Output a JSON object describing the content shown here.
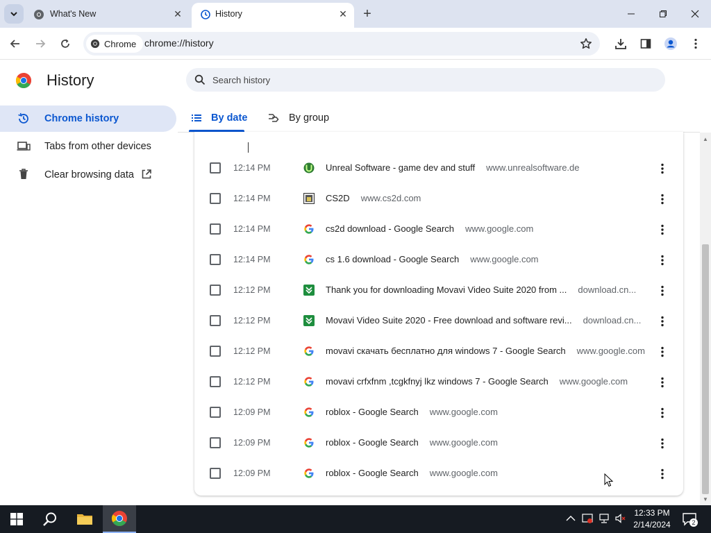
{
  "browser": {
    "tabs": [
      {
        "title": "What's New",
        "active": false
      },
      {
        "title": "History",
        "active": true
      }
    ],
    "address": {
      "chip_label": "Chrome",
      "url": "chrome://history"
    }
  },
  "page": {
    "title": "History",
    "search_placeholder": "Search history"
  },
  "sidebar": {
    "items": [
      {
        "label": "Chrome history",
        "icon": "history-icon",
        "active": true
      },
      {
        "label": "Tabs from other devices",
        "icon": "devices-icon",
        "active": false
      },
      {
        "label": "Clear browsing data",
        "icon": "trash-icon",
        "active": false
      }
    ]
  },
  "view_tabs": [
    {
      "label": "By date",
      "active": true
    },
    {
      "label": "By group",
      "active": false
    }
  ],
  "history": {
    "rows": [
      {
        "time": "12:14 PM",
        "title": "Unreal Software - game dev and stuff",
        "domain": "www.unrealsoftware.de",
        "favicon": "unreal-favicon"
      },
      {
        "time": "12:14 PM",
        "title": "CS2D",
        "domain": "www.cs2d.com",
        "favicon": "cs2d-favicon"
      },
      {
        "time": "12:14 PM",
        "title": "cs2d download - Google Search",
        "domain": "www.google.com",
        "favicon": "google-favicon"
      },
      {
        "time": "12:14 PM",
        "title": "cs 1.6 download - Google Search",
        "domain": "www.google.com",
        "favicon": "google-favicon"
      },
      {
        "time": "12:12 PM",
        "title": "Thank you for downloading Movavi Video Suite 2020 from ...",
        "domain": "download.cn...",
        "favicon": "cnet-favicon"
      },
      {
        "time": "12:12 PM",
        "title": "Movavi Video Suite 2020 - Free download and software revi...",
        "domain": "download.cn...",
        "favicon": "cnet-favicon"
      },
      {
        "time": "12:12 PM",
        "title": "movavi скачать бесплатно для windows 7 - Google Search",
        "domain": "www.google.com",
        "favicon": "google-favicon"
      },
      {
        "time": "12:12 PM",
        "title": "movavi crfxfnm ,tcgkfnyj lkz windows 7 - Google Search",
        "domain": "www.google.com",
        "favicon": "google-favicon"
      },
      {
        "time": "12:09 PM",
        "title": "roblox - Google Search",
        "domain": "www.google.com",
        "favicon": "google-favicon"
      },
      {
        "time": "12:09 PM",
        "title": "roblox - Google Search",
        "domain": "www.google.com",
        "favicon": "google-favicon"
      },
      {
        "time": "12:09 PM",
        "title": "roblox - Google Search",
        "domain": "www.google.com",
        "favicon": "google-favicon"
      }
    ]
  },
  "taskbar": {
    "clock_time": "12:33 PM",
    "clock_date": "2/14/2024",
    "notification_count": "2"
  },
  "colors": {
    "accent": "#0b57d0",
    "tabstrip": "#dde3f0",
    "sidebar_active": "#dfe6f6",
    "taskbar": "#161b22"
  }
}
